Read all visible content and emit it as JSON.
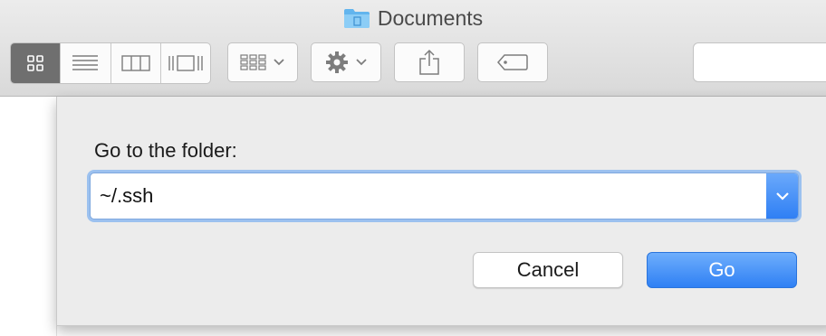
{
  "window": {
    "title": "Documents",
    "folder_icon": "folder-icon"
  },
  "toolbar": {
    "view_modes": [
      {
        "name": "icon-view",
        "icon": "grid-icon",
        "active": true
      },
      {
        "name": "list-view",
        "icon": "list-icon",
        "active": false
      },
      {
        "name": "column-view",
        "icon": "columns-icon",
        "active": false
      },
      {
        "name": "cover-flow-view",
        "icon": "cover-flow-icon",
        "active": false
      }
    ],
    "arrange_icon": "arrange-grid-icon",
    "action_icon": "gear-icon",
    "share_icon": "share-icon",
    "tag_icon": "tag-icon"
  },
  "dialog": {
    "prompt": "Go to the folder:",
    "path_value": "~/.ssh",
    "cancel_label": "Cancel",
    "go_label": "Go"
  },
  "colors": {
    "accent": "#2f80f4",
    "focus_ring": "#9cc1ef",
    "sheet_bg": "#ececec"
  }
}
